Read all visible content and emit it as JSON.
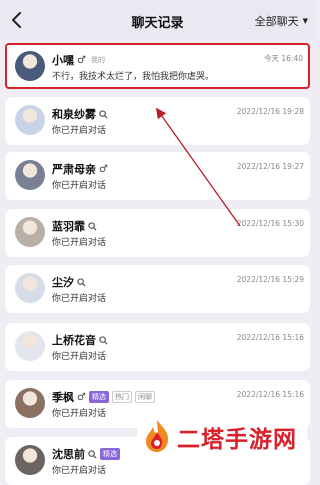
{
  "header": {
    "title": "聊天记录",
    "filter_label": "全部聊天",
    "back_icon": "chevron-left-icon"
  },
  "chats": [
    {
      "name": "小嘿",
      "gender": "♂",
      "tag": "我的",
      "badge": "",
      "extra_tags": [],
      "search_icon": false,
      "message": "不行，我技术太烂了，我怕我把你虐哭。",
      "time": "今天 16:40",
      "highlighted": true,
      "avatar_color": "#4a5a7a"
    },
    {
      "name": "和泉纱雾",
      "gender": "",
      "tag": "",
      "badge": "",
      "extra_tags": [],
      "search_icon": true,
      "message": "你已开启对话",
      "time": "2022/12/16 19:28",
      "highlighted": false,
      "avatar_color": "#c9d3e6"
    },
    {
      "name": "严肃母亲",
      "gender": "♂",
      "tag": "",
      "badge": "",
      "extra_tags": [],
      "search_icon": false,
      "message": "你已开启对话",
      "time": "2022/12/16 19:27",
      "highlighted": false,
      "avatar_color": "#7a8094"
    },
    {
      "name": "蓝羽霏",
      "gender": "",
      "tag": "",
      "badge": "",
      "extra_tags": [],
      "search_icon": true,
      "message": "你已开启对话",
      "time": "2022/12/16 15:30",
      "highlighted": false,
      "avatar_color": "#b8b0a6"
    },
    {
      "name": "尘汐",
      "gender": "",
      "tag": "",
      "badge": "",
      "extra_tags": [],
      "search_icon": true,
      "message": "你已开启对话",
      "time": "2022/12/16 15:29",
      "highlighted": false,
      "avatar_color": "#d7dde6"
    },
    {
      "name": "上桥花音",
      "gender": "",
      "tag": "",
      "badge": "",
      "extra_tags": [],
      "search_icon": true,
      "message": "你已开启对话",
      "time": "2022/12/16 15:16",
      "highlighted": false,
      "avatar_color": "#e3e6ec"
    },
    {
      "name": "季枫",
      "gender": "♂",
      "tag": "",
      "badge": "精选",
      "extra_tags": [
        "热门",
        "闲聊"
      ],
      "search_icon": false,
      "message": "你已开启对话",
      "time": "2022/12/16 15:16",
      "highlighted": false,
      "avatar_color": "#8a7060"
    },
    {
      "name": "沈思前",
      "gender": "",
      "tag": "",
      "badge": "精选",
      "extra_tags": [],
      "search_icon": true,
      "message": "你已开启对话",
      "time": "",
      "highlighted": false,
      "avatar_color": "#6b6460"
    }
  ],
  "watermark": {
    "text": "二塔手游网",
    "color": "#d9212c"
  },
  "annotation": {
    "color": "#b81e2a"
  }
}
